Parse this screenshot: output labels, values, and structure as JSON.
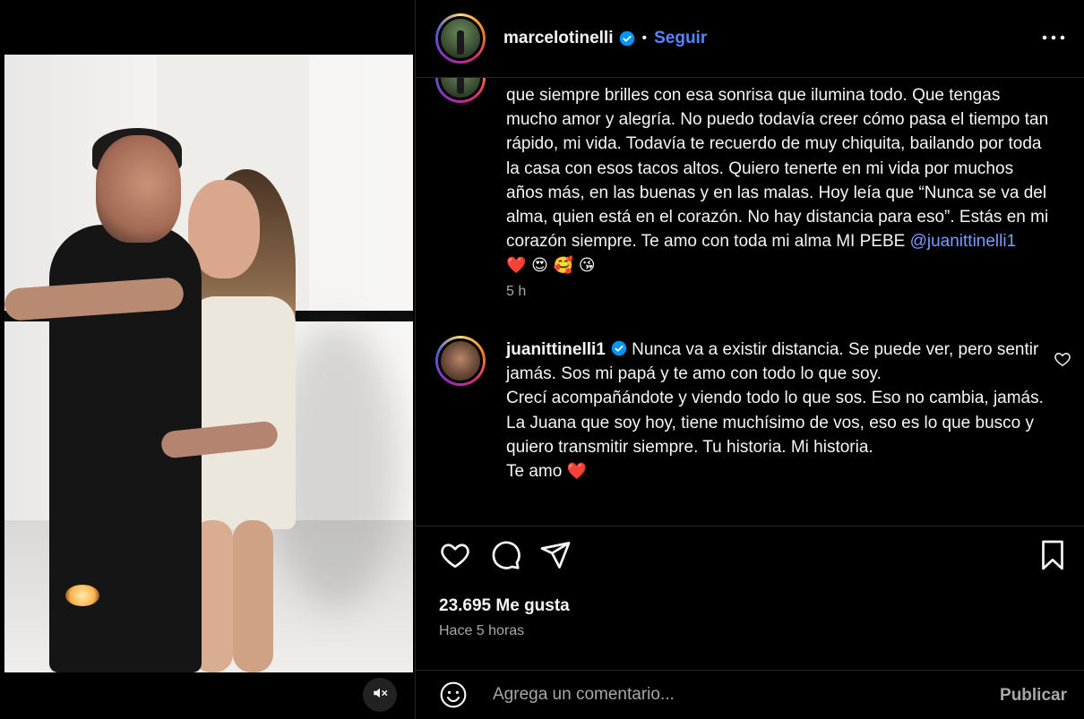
{
  "post": {
    "author": "marcelotinelli",
    "follow_label": "Seguir",
    "dot": "•"
  },
  "caption": {
    "text": "que siempre brilles con esa sonrisa que ilumina todo. Que tengas mucho amor y alegría. No puedo todavía creer cómo pasa el tiempo tan rápido, mi vida. Todavía te recuerdo de muy chiquita, bailando por toda la casa con esos tacos altos. Quiero tenerte en mi vida por muchos años más, en las buenas y en las malas. Hoy leía que “Nunca se va del alma, quien está en el corazón. No hay distancia para eso”. Estás en mi corazón siempre. Te amo con toda mi alma MI PEBE ",
    "mention": "@juanittinelli1",
    "emojis": "❤️ 😍 🥰 😘",
    "time": "5 h"
  },
  "reply": {
    "username": "juanittinelli1",
    "text": "Nunca va a existir distancia. Se puede ver, pero sentir jamás. Sos mi papá y te amo con todo lo que soy.\nCrecí acompañándote y viendo todo lo que sos. Eso no cambia, jamás.\nLa Juana que soy hoy, tiene muchísimo de vos, eso es lo que busco y quiero transmitir siempre. Tu historia. Mi historia.\nTe amo ",
    "emoji": "❤️"
  },
  "actions": {
    "likes": "23.695 Me gusta",
    "ago": "Hace 5 horas"
  },
  "composer": {
    "placeholder": "Agrega un comentario...",
    "publish_label": "Publicar"
  },
  "colors": {
    "background": "#000000",
    "link": "#5b82ff",
    "muted": "#a8a8a8",
    "verified": "#0095f6",
    "like_red": "#ff3040"
  },
  "icons": [
    "mute-icon",
    "verified-icon",
    "more-icon",
    "heart-icon",
    "comment-icon",
    "share-icon",
    "bookmark-icon",
    "emoji-icon"
  ]
}
